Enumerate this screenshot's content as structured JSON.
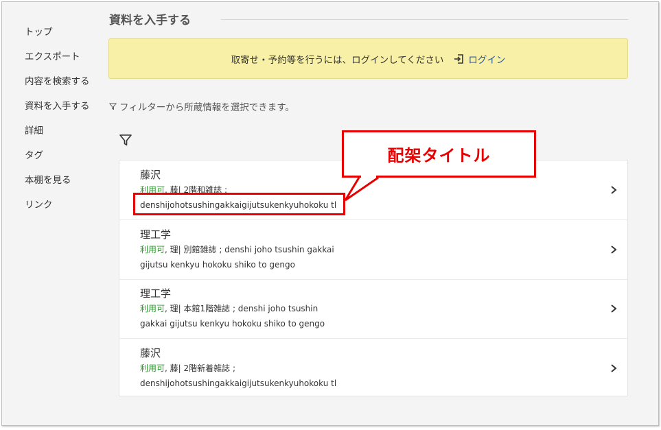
{
  "sidebar": {
    "items": [
      {
        "label": "トップ"
      },
      {
        "label": "エクスポート"
      },
      {
        "label": "内容を検索する"
      },
      {
        "label": "資料を入手する"
      },
      {
        "label": "詳細"
      },
      {
        "label": "タグ"
      },
      {
        "label": "本棚を見る"
      },
      {
        "label": "リンク"
      }
    ]
  },
  "section": {
    "title": "資料を入手する"
  },
  "notice": {
    "text": "取寄せ・予約等を行うには、ログインしてください",
    "login_label": "ログイン"
  },
  "hint": {
    "text": "フィルターから所蔵情報を選択できます。"
  },
  "holdings": [
    {
      "location": "藤沢",
      "status": "利用可",
      "line1": ", 藤| 2階和雑誌 ;",
      "line2": "denshijohotsushingakkaigijutsukenkyuhokoku tl"
    },
    {
      "location": "理工学",
      "status": "利用可",
      "line1": ", 理| 別館雑誌 ; denshi joho tsushin gakkai",
      "line2": "gijutsu kenkyu hokoku shiko to gengo"
    },
    {
      "location": "理工学",
      "status": "利用可",
      "line1": ", 理| 本館1階雑誌 ; denshi joho tsushin",
      "line2": "gakkai gijutsu kenkyu hokoku shiko to gengo"
    },
    {
      "location": "藤沢",
      "status": "利用可",
      "line1": ", 藤| 2階新着雑誌 ;",
      "line2": "denshijohotsushingakkaigijutsukenkyuhokoku tl"
    }
  ],
  "callout": {
    "label": "配架タイトル",
    "color": "#e60000"
  },
  "colors": {
    "available": "#2d9a2d",
    "notice_bg": "#f7f0a6",
    "link": "#2a5a9c"
  },
  "icons": {
    "login": "login-icon",
    "filter": "filter-icon",
    "chevron": "chevron-right-icon"
  }
}
